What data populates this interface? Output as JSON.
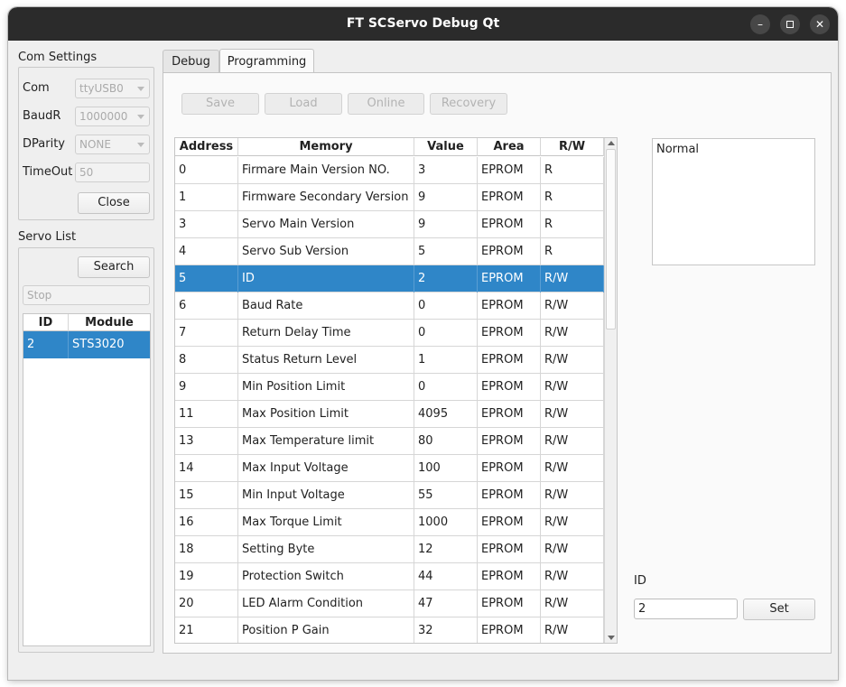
{
  "window": {
    "title": "FT SCServo Debug Qt"
  },
  "com_settings": {
    "title": "Com Settings",
    "com_label": "Com",
    "com_value": "ttyUSB0",
    "baud_label": "BaudR",
    "baud_value": "1000000",
    "parity_label": "DParity",
    "parity_value": "NONE",
    "timeout_label": "TimeOut",
    "timeout_value": "50",
    "close_label": "Close"
  },
  "servo_list": {
    "title": "Servo List",
    "search_label": "Search",
    "stop_placeholder": "Stop",
    "columns": [
      "ID",
      "Module"
    ],
    "rows": [
      {
        "id": "2",
        "module": "STS3020"
      }
    ]
  },
  "tabs": [
    "Debug",
    "Programming"
  ],
  "toolbar": {
    "save": "Save",
    "load": "Load",
    "online": "Online",
    "recovery": "Recovery"
  },
  "memory_table": {
    "columns": [
      "Address",
      "Memory",
      "Value",
      "Area",
      "R/W"
    ],
    "rows": [
      {
        "address": "0",
        "memory": "Firmare Main Version NO.",
        "value": "3",
        "area": "EPROM",
        "rw": "R"
      },
      {
        "address": "1",
        "memory": "Firmware Secondary Version ...",
        "value": "9",
        "area": "EPROM",
        "rw": "R"
      },
      {
        "address": "3",
        "memory": "Servo Main Version",
        "value": "9",
        "area": "EPROM",
        "rw": "R"
      },
      {
        "address": "4",
        "memory": "Servo Sub Version",
        "value": "5",
        "area": "EPROM",
        "rw": "R"
      },
      {
        "address": "5",
        "memory": "ID",
        "value": "2",
        "area": "EPROM",
        "rw": "R/W"
      },
      {
        "address": "6",
        "memory": "Baud Rate",
        "value": "0",
        "area": "EPROM",
        "rw": "R/W"
      },
      {
        "address": "7",
        "memory": "Return Delay Time",
        "value": "0",
        "area": "EPROM",
        "rw": "R/W"
      },
      {
        "address": "8",
        "memory": "Status Return Level",
        "value": "1",
        "area": "EPROM",
        "rw": "R/W"
      },
      {
        "address": "9",
        "memory": "Min Position Limit",
        "value": "0",
        "area": "EPROM",
        "rw": "R/W"
      },
      {
        "address": "11",
        "memory": "Max Position Limit",
        "value": "4095",
        "area": "EPROM",
        "rw": "R/W"
      },
      {
        "address": "13",
        "memory": "Max Temperature limit",
        "value": "80",
        "area": "EPROM",
        "rw": "R/W"
      },
      {
        "address": "14",
        "memory": "Max Input Voltage",
        "value": "100",
        "area": "EPROM",
        "rw": "R/W"
      },
      {
        "address": "15",
        "memory": "Min Input Voltage",
        "value": "55",
        "area": "EPROM",
        "rw": "R/W"
      },
      {
        "address": "16",
        "memory": "Max Torque Limit",
        "value": "1000",
        "area": "EPROM",
        "rw": "R/W"
      },
      {
        "address": "18",
        "memory": "Setting Byte",
        "value": "12",
        "area": "EPROM",
        "rw": "R/W"
      },
      {
        "address": "19",
        "memory": "Protection Switch",
        "value": "44",
        "area": "EPROM",
        "rw": "R/W"
      },
      {
        "address": "20",
        "memory": "LED Alarm Condition",
        "value": "47",
        "area": "EPROM",
        "rw": "R/W"
      },
      {
        "address": "21",
        "memory": "Position P Gain",
        "value": "32",
        "area": "EPROM",
        "rw": "R/W"
      }
    ],
    "selected_address": "5"
  },
  "status_text": "Normal",
  "id_setter": {
    "label": "ID",
    "value": "2",
    "set_label": "Set"
  },
  "icons": {
    "minimize": "minimize-icon",
    "maximize": "maximize-icon",
    "close": "close-icon"
  },
  "colors": {
    "selection": "#2f86c8",
    "titlebar": "#2b2b2b"
  }
}
